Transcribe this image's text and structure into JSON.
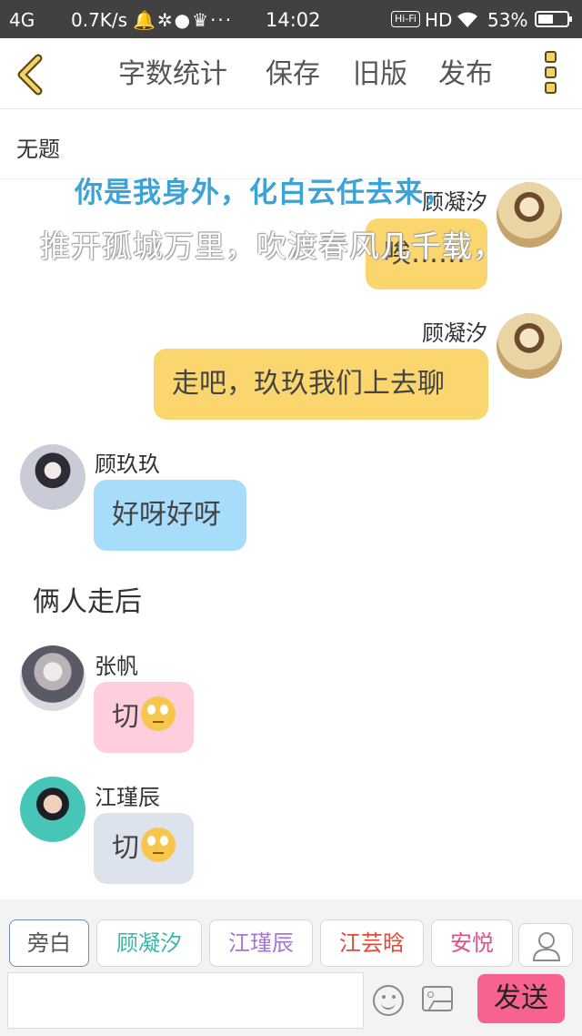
{
  "status_bar": {
    "network": "4G",
    "speed": "0.7K/s",
    "notif_icons": [
      "bell-icon",
      "pinwheel-icon",
      "planet-icon",
      "crown-icon"
    ],
    "more": "···",
    "time": "14:02",
    "hifi": "Hi-Fi",
    "hd": "HD",
    "battery": "53%",
    "battery_level": 0.53
  },
  "header": {
    "word_count": "字数统计",
    "save": "保存",
    "old_version": "旧版",
    "publish": "发布"
  },
  "title": "无题",
  "overlay": {
    "line1": "你是我身外，化白云任去来，",
    "line2": "推开孤城万里，吹渡春风几千载，"
  },
  "messages": [
    {
      "side": "right",
      "name": "顾凝汐",
      "text": "唉……",
      "color": "#fbd66e"
    },
    {
      "side": "right",
      "name": "顾凝汐",
      "text": "走吧，玖玖我们上去聊",
      "color": "#fbd66e"
    },
    {
      "side": "left",
      "name": "顾玖玖",
      "text": "好呀好呀",
      "color": "#a8dcfb"
    },
    {
      "side": "left",
      "name": "张帆",
      "text": "切",
      "emoji": "eye-roll-emoji",
      "color": "#fecedc"
    },
    {
      "side": "left",
      "name": "江瑾辰",
      "text": "切",
      "emoji": "eye-roll-emoji",
      "color": "#dde3ec"
    }
  ],
  "narration": "俩人走后",
  "roles": [
    {
      "label": "旁白",
      "color": "#555555"
    },
    {
      "label": "顾凝汐",
      "color": "#3ab7a8"
    },
    {
      "label": "江瑾辰",
      "color": "#a576d4"
    },
    {
      "label": "江芸晗",
      "color": "#e04a3a"
    },
    {
      "label": "安悦",
      "color": "#e0508c"
    }
  ],
  "input": {
    "placeholder": ""
  },
  "send_label": "发送"
}
